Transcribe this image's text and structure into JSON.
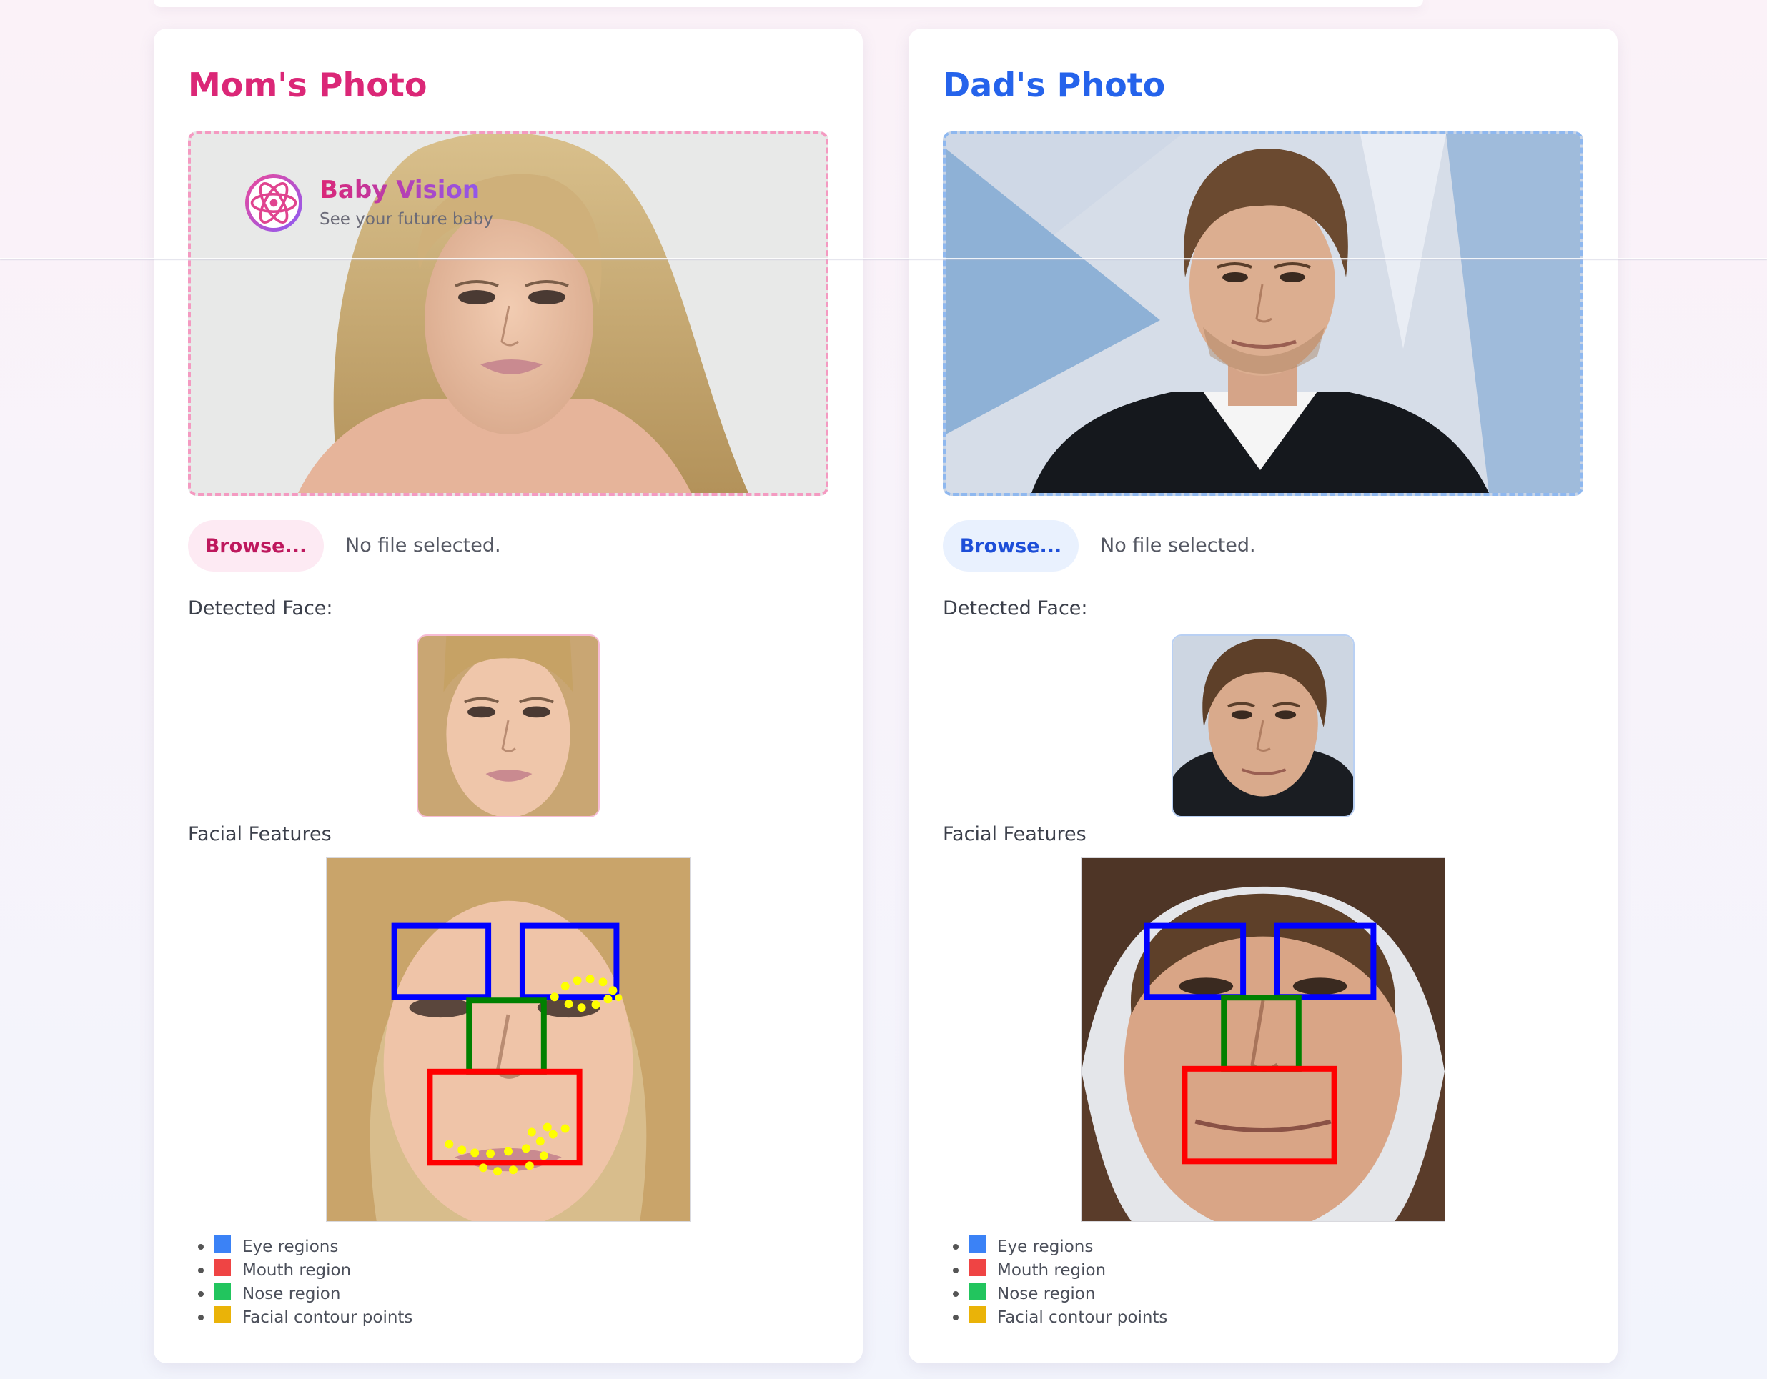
{
  "brand": {
    "name": "Baby Vision",
    "tagline": "See your future baby",
    "icon": "atom-icon"
  },
  "mom": {
    "title": "Mom's Photo",
    "browse_label": "Browse...",
    "file_status": "No file selected.",
    "detected_label": "Detected Face:",
    "features_label": "Facial Features",
    "accent": "#db2777"
  },
  "dad": {
    "title": "Dad's Photo",
    "browse_label": "Browse...",
    "file_status": "No file selected.",
    "detected_label": "Detected Face:",
    "features_label": "Facial Features",
    "accent": "#2563eb"
  },
  "legend": [
    {
      "label": "Eye regions",
      "color": "#3b82f6"
    },
    {
      "label": "Mouth region",
      "color": "#ef4444"
    },
    {
      "label": "Nose region",
      "color": "#22c55e"
    },
    {
      "label": "Facial contour points",
      "color": "#eab308"
    }
  ],
  "overlay_colors": {
    "eyes": "#0000ff",
    "nose": "#008000",
    "mouth": "#ff0000",
    "contour": "#ffff00"
  }
}
